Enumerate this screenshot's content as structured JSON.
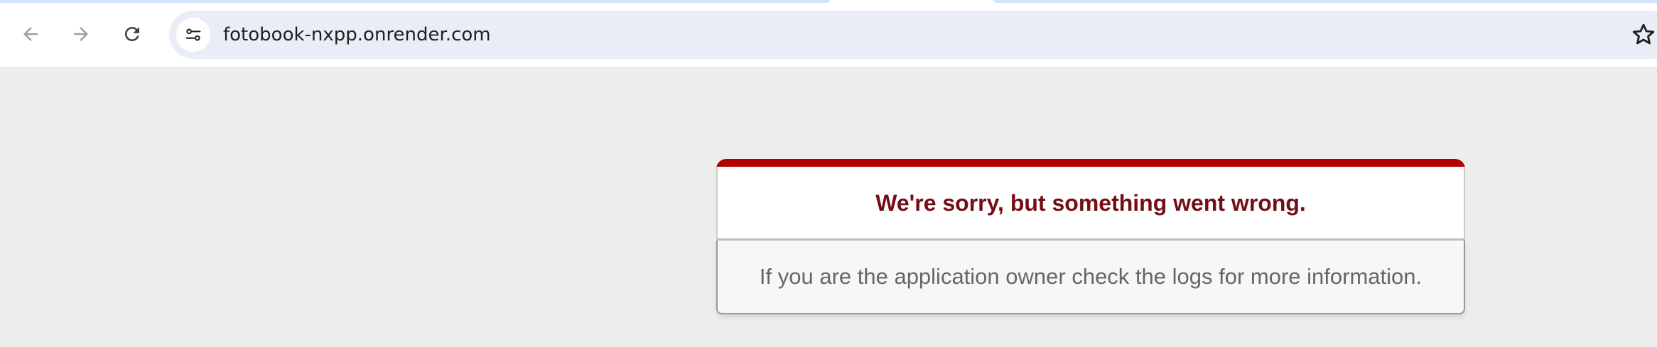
{
  "browser": {
    "url": "fotobook-nxpp.onrender.com",
    "icons": {
      "back": "arrow-left-icon",
      "forward": "arrow-right-icon",
      "reload": "reload-icon",
      "site_info": "tune-icon",
      "bookmark": "star-outline-icon"
    }
  },
  "error": {
    "title": "We're sorry, but something went wrong.",
    "message": "If you are the application owner check the logs for more information."
  },
  "colors": {
    "accent_red": "#b20202",
    "title_red": "#730e15",
    "page_background": "#ededed",
    "omnibox": "#e9edf6"
  }
}
